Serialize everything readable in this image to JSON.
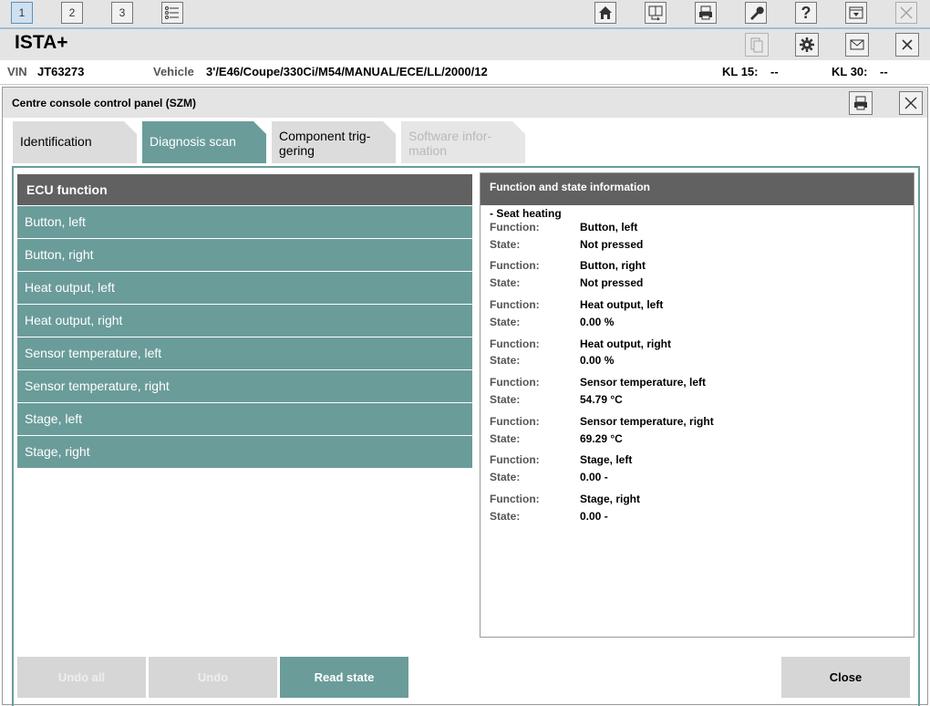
{
  "toolbar": {
    "tabs": [
      "1",
      "2",
      "3"
    ]
  },
  "app": {
    "title": "ISTA+"
  },
  "vehicle_bar": {
    "vin_label": "VIN",
    "vin_value": "JT63273",
    "vehicle_label": "Vehicle",
    "vehicle_value": "3'/E46/Coupe/330Ci/M54/MANUAL/ECE/LL/2000/12",
    "kl15_label": "KL 15:",
    "kl15_value": "--",
    "kl30_label": "KL 30:",
    "kl30_value": "--"
  },
  "dialog": {
    "title": "Centre console control panel (SZM)",
    "tabs": [
      {
        "label": "Identification"
      },
      {
        "label": "Diagnosis scan"
      },
      {
        "label_l1": "Component trig-",
        "label_l2": "gering"
      },
      {
        "label_l1": "Software infor-",
        "label_l2": "mation"
      }
    ]
  },
  "ecu": {
    "header": "ECU function",
    "items": [
      "Button, left",
      "Button, right",
      "Heat output, left",
      "Heat output, right",
      "Sensor temperature, left",
      "Sensor temperature, right",
      "Stage, left",
      "Stage, right"
    ]
  },
  "info": {
    "header": "Function and state information",
    "group": "- Seat heating",
    "function_label": "Function:",
    "state_label": "State:",
    "entries": [
      {
        "function": "Button, left",
        "state": "Not pressed"
      },
      {
        "function": "Button, right",
        "state": "Not pressed"
      },
      {
        "function": "Heat output, left",
        "state": "0.00  %"
      },
      {
        "function": "Heat output, right",
        "state": "0.00  %"
      },
      {
        "function": "Sensor temperature, left",
        "state": "54.79  °C"
      },
      {
        "function": "Sensor temperature, right",
        "state": "69.29  °C"
      },
      {
        "function": "Stage, left",
        "state": "0.00  -"
      },
      {
        "function": "Stage, right",
        "state": "0.00  -"
      }
    ]
  },
  "buttons": {
    "undo_all": "Undo all",
    "undo": "Undo",
    "read_state": "Read state",
    "close": "Close"
  },
  "colors": {
    "accent_teal": "#6a9c9a",
    "header_dark": "#616161",
    "chrome_grey": "#e4e4e4"
  }
}
